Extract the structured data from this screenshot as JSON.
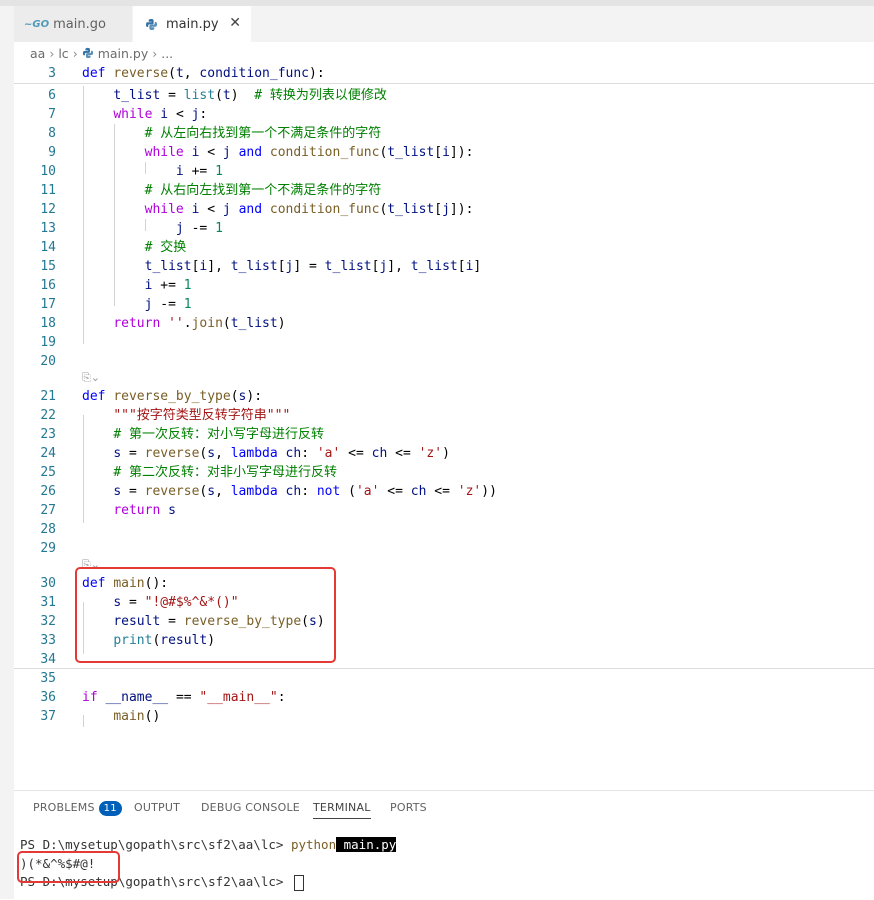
{
  "tabs": [
    {
      "label": "main.go"
    },
    {
      "label": "main.py"
    }
  ],
  "breadcrumb": [
    "aa",
    "lc",
    "main.py",
    "..."
  ],
  "code_lines": [
    {
      "n": "3",
      "t": "def reverse(t, condition_func):"
    },
    {
      "n": "6",
      "t": "    t_list = list(t)  # 转换为列表以便修改"
    },
    {
      "n": "7",
      "t": "    while i < j:"
    },
    {
      "n": "8",
      "t": "        # 从左向右找到第一个不满足条件的字符"
    },
    {
      "n": "9",
      "t": "        while i < j and condition_func(t_list[i]):"
    },
    {
      "n": "10",
      "t": "            i += 1"
    },
    {
      "n": "11",
      "t": "        # 从右向左找到第一个不满足条件的字符"
    },
    {
      "n": "12",
      "t": "        while i < j and condition_func(t_list[j]):"
    },
    {
      "n": "13",
      "t": "            j -= 1"
    },
    {
      "n": "14",
      "t": "        # 交换"
    },
    {
      "n": "15",
      "t": "        t_list[i], t_list[j] = t_list[j], t_list[i]"
    },
    {
      "n": "16",
      "t": "        i += 1"
    },
    {
      "n": "17",
      "t": "        j -= 1"
    },
    {
      "n": "18",
      "t": "    return ''.join(t_list)"
    },
    {
      "n": "19",
      "t": ""
    },
    {
      "n": "20",
      "t": ""
    },
    {
      "n": "21",
      "t": "def reverse_by_type(s):"
    },
    {
      "n": "22",
      "t": "    \"\"\"按字符类型反转字符串\"\"\""
    },
    {
      "n": "23",
      "t": "    # 第一次反转：对小写字母进行反转"
    },
    {
      "n": "24",
      "t": "    s = reverse(s, lambda ch: 'a' <= ch <= 'z')"
    },
    {
      "n": "25",
      "t": "    # 第二次反转：对非小写字母进行反转"
    },
    {
      "n": "26",
      "t": "    s = reverse(s, lambda ch: not ('a' <= ch <= 'z'))"
    },
    {
      "n": "27",
      "t": "    return s"
    },
    {
      "n": "28",
      "t": ""
    },
    {
      "n": "29",
      "t": ""
    },
    {
      "n": "30",
      "t": "def main():"
    },
    {
      "n": "31",
      "t": "    s = \"!@#$%^&*()\""
    },
    {
      "n": "32",
      "t": "    result = reverse_by_type(s)"
    },
    {
      "n": "33",
      "t": "    print(result)"
    },
    {
      "n": "34",
      "t": ""
    },
    {
      "n": "35",
      "t": ""
    },
    {
      "n": "36",
      "t": "if __name__ == \"__main__\":"
    },
    {
      "n": "37",
      "t": "    main()"
    }
  ],
  "panel": {
    "tabs": [
      "PROBLEMS",
      "OUTPUT",
      "DEBUG CONSOLE",
      "TERMINAL",
      "PORTS"
    ],
    "problems_count": "11",
    "active_tab": "TERMINAL"
  },
  "terminal": {
    "prompt1": "PS D:\\mysetup\\gopath\\src\\sf2\\aa\\lc> ",
    "cmd_word": "python",
    "cmd_arg": " main.py",
    "output": ")(*&^%$#@!",
    "prompt2": "PS D:\\mysetup\\gopath\\src\\sf2\\aa\\lc> "
  },
  "colors": {
    "highlight_box": "#e53935",
    "accent": "#005fb8"
  },
  "icons": [
    "go-file-icon",
    "python-file-icon",
    "close-icon",
    "codelens-icon",
    "chevron-down-icon"
  ]
}
